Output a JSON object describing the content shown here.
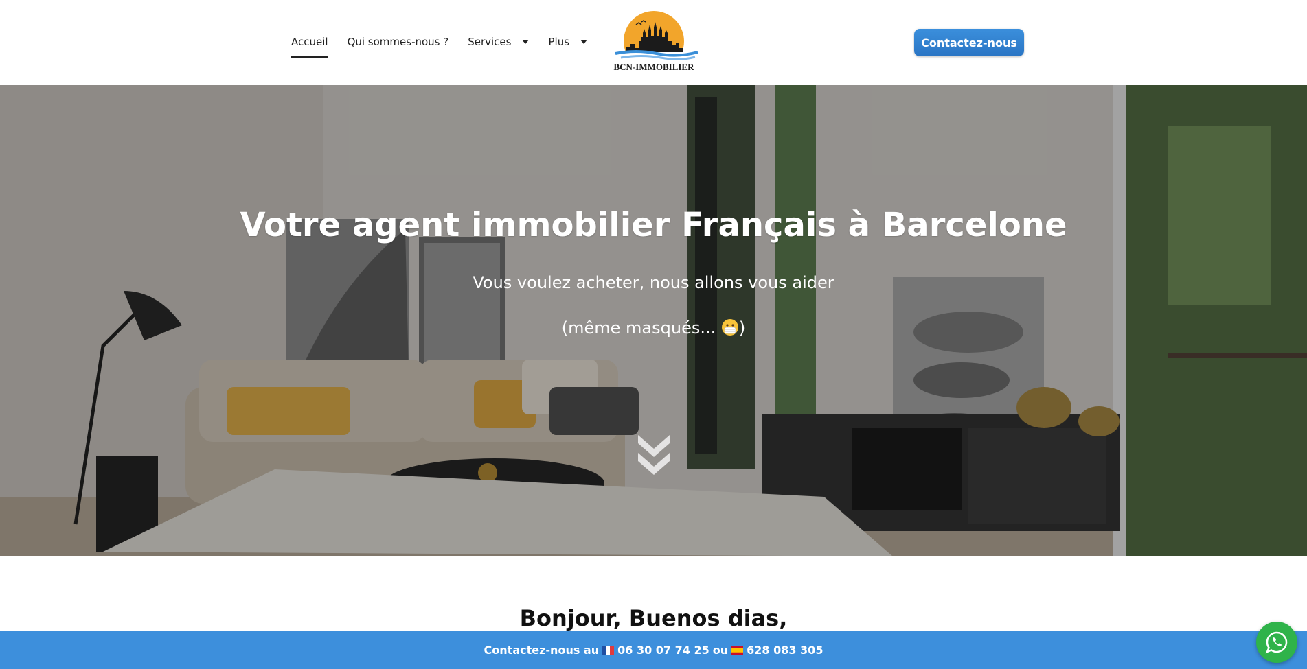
{
  "header": {
    "nav": [
      {
        "label": "Accueil",
        "active": true,
        "dropdown": false
      },
      {
        "label": "Qui sommes-nous ?",
        "active": false,
        "dropdown": false
      },
      {
        "label": "Services",
        "active": false,
        "dropdown": true
      },
      {
        "label": "Plus",
        "active": false,
        "dropdown": true
      }
    ],
    "logo_text": "BCN-IMMOBILIER",
    "cta_label": "Contactez-nous"
  },
  "hero": {
    "title": "Votre agent immobilier Français à Barcelone",
    "subtitle_1": "Vous voulez acheter, nous allons vous aider",
    "subtitle_2_prefix": "(même masqués... ",
    "subtitle_2_suffix": ")",
    "scroll_icon": "double-chevron-down-icon"
  },
  "content": {
    "greeting": "Bonjour, Buenos dias,"
  },
  "contact_bar": {
    "prefix": "Contactez-nous au",
    "phone_fr": "06 30 07 74 25",
    "separator": "ou",
    "phone_es": "628 083 305",
    "flag_fr": "france-flag-icon",
    "flag_es": "spain-flag-icon"
  },
  "whatsapp_icon": "whatsapp-icon",
  "colors": {
    "accent_blue": "#3d8fdc",
    "button_blue": "#2a75c4",
    "whatsapp_green": "#2fb34a",
    "logo_orange": "#f2a52b"
  }
}
